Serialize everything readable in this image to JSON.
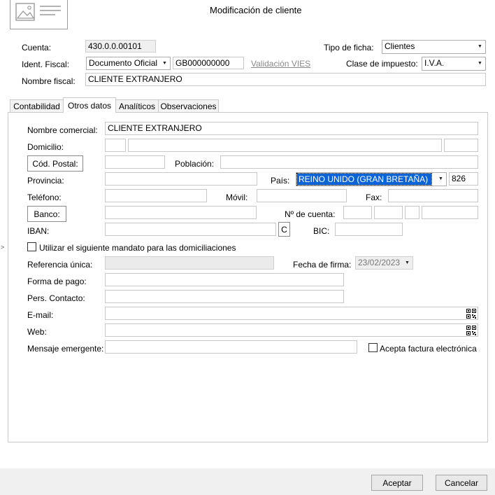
{
  "window": {
    "title": "Modificación de cliente"
  },
  "header": {
    "cuenta_label": "Cuenta:",
    "cuenta_value": "430.0.0.00101",
    "ident_label": "Ident. Fiscal:",
    "ident_type": "Documento Oficial",
    "ident_value": "GB000000000",
    "vies_link": "Validación VIES",
    "nombre_fiscal_label": "Nombre fiscal:",
    "nombre_fiscal_value": "CLIENTE EXTRANJERO",
    "tipo_ficha_label": "Tipo de ficha:",
    "tipo_ficha_value": "Clientes",
    "clase_impuesto_label": "Clase de impuesto:",
    "clase_impuesto_value": "I.V.A."
  },
  "tabs": [
    {
      "label": "Contabilidad",
      "active": false
    },
    {
      "label": "Otros datos",
      "active": true
    },
    {
      "label": "Analíticos",
      "active": false
    },
    {
      "label": "Observaciones",
      "active": false
    }
  ],
  "form": {
    "nombre_comercial_label": "Nombre comercial:",
    "nombre_comercial_value": "CLIENTE EXTRANJERO",
    "domicilio_label": "Domicilio:",
    "cod_postal_button": "Cód. Postal:",
    "poblacion_label": "Población:",
    "provincia_label": "Provincia:",
    "pais_label": "País:",
    "pais_value": "REINO UNIDO (GRAN BRETAÑA)",
    "pais_code": "826",
    "telefono_label": "Teléfono:",
    "movil_label": "Móvil:",
    "fax_label": "Fax:",
    "banco_button": "Banco:",
    "n_cuenta_label": "Nº de cuenta:",
    "iban_label": "IBAN:",
    "iban_button": "C",
    "bic_label": "BIC:",
    "mandato_checkbox_label": "Utilizar el siguiente mandato para las domiciliaciones",
    "referencia_label": "Referencia única:",
    "fecha_firma_label": "Fecha de firma:",
    "fecha_firma_value": "23/02/2023",
    "forma_pago_label": "Forma de pago:",
    "pers_contacto_label": "Pers. Contacto:",
    "email_label": "E-mail:",
    "web_label": "Web:",
    "mensaje_label": "Mensaje emergente:",
    "factura_electronica_label": "Acepta factura electrónica"
  },
  "footer": {
    "accept_label": "Aceptar",
    "cancel_label": "Cancelar"
  },
  "icons": {
    "image_placeholder": "image-card-icon",
    "qr": "qr-code-icon",
    "side_arrow": "chevron-right-icon",
    "dropdown": "chevron-down-icon"
  },
  "colors": {
    "selection": "#0a64d6",
    "footer_bg": "#f0f0f0",
    "link": "#8a8a8a"
  }
}
